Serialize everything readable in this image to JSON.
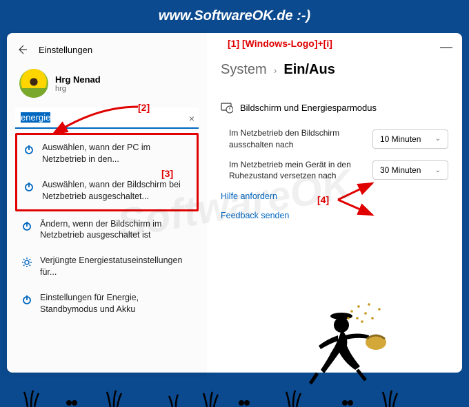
{
  "header": {
    "site": "www.SoftwareOK.de :-)"
  },
  "watermark": "SoftwareOK",
  "annotations": {
    "a1": "[1]  [Windows-Logo]+[i]",
    "a2": "[2]",
    "a3": "[3]",
    "a4": "[4]"
  },
  "left": {
    "back_title": "Einstellungen",
    "user_name": "Hrg Nenad",
    "user_sub": "hrg",
    "search_value": "energie",
    "results_boxed": [
      "Auswählen, wann der PC im Netzbetrieb in den...",
      "Auswählen, wann der Bildschirm bei Netzbetrieb ausgeschaltet..."
    ],
    "results_plain": [
      {
        "icon": "power",
        "text": "Ändern, wenn der Bildschirm im Netzbetrieb ausgeschaltet ist"
      },
      {
        "icon": "gear",
        "text": "Verjüngte Energiestatuseinstellungen für..."
      },
      {
        "icon": "power",
        "text": "Einstellungen für Energie, Standbymodus und Akku"
      }
    ]
  },
  "right": {
    "bc_system": "System",
    "bc_current": "Ein/Aus",
    "section": "Bildschirm und Energiesparmodus",
    "settings": [
      {
        "label": "Im Netzbetrieb den Bildschirm ausschalten nach",
        "value": "10 Minuten"
      },
      {
        "label": "Im Netzbetrieb mein Gerät in den Ruhezustand versetzen nach",
        "value": "30 Minuten"
      }
    ],
    "links": {
      "help": "Hilfe anfordern",
      "feedback": "Feedback senden"
    }
  }
}
